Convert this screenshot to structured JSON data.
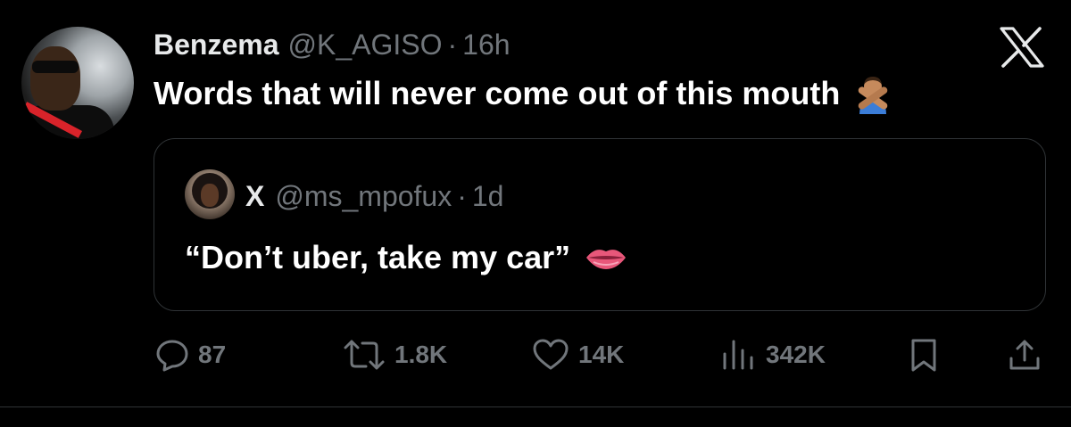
{
  "author": {
    "name": "Benzema",
    "handle": "@K_AGISO",
    "separator": "·",
    "time": "16h"
  },
  "tweet": {
    "text": "Words that will never come out of this mouth",
    "emoji_icon": "person-gesturing-no-icon"
  },
  "brand": {
    "logo_icon": "x-logo-icon"
  },
  "quoted": {
    "name": "X",
    "handle": "@ms_mpofux",
    "separator": "·",
    "time": "1d",
    "text": "“Don’t uber, take my car”",
    "emoji_icon": "lips-icon"
  },
  "actions": {
    "replies": "87",
    "reposts": "1.8K",
    "likes": "14K",
    "views": "342K"
  },
  "colors": {
    "background": "#000000",
    "primary_text": "#e7e9ea",
    "secondary_text": "#71767b",
    "border": "#2f3336"
  }
}
